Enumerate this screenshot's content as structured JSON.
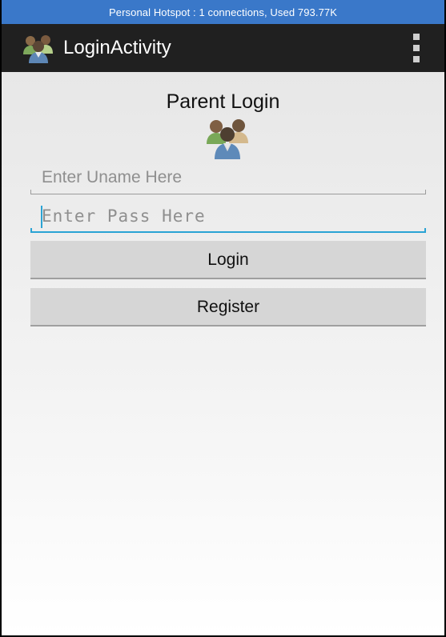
{
  "status_bar": {
    "text": "Personal Hotspot : 1 connections, Used 793.77K"
  },
  "action_bar": {
    "title": "LoginActivity",
    "icon": "parent-group-icon",
    "menu_icon": "overflow-menu-icon"
  },
  "main": {
    "title": "Parent Login",
    "icon": "parent-group-icon",
    "username": {
      "value": "",
      "placeholder": "Enter Uname Here"
    },
    "password": {
      "value": "",
      "placeholder": "Enter Pass Here"
    },
    "buttons": {
      "login": "Login",
      "register": "Register"
    }
  },
  "colors": {
    "status_bar": "#3a78c9",
    "action_bar": "#202020",
    "focus_accent": "#2aa3d4",
    "button_bg": "#d6d6d6"
  }
}
